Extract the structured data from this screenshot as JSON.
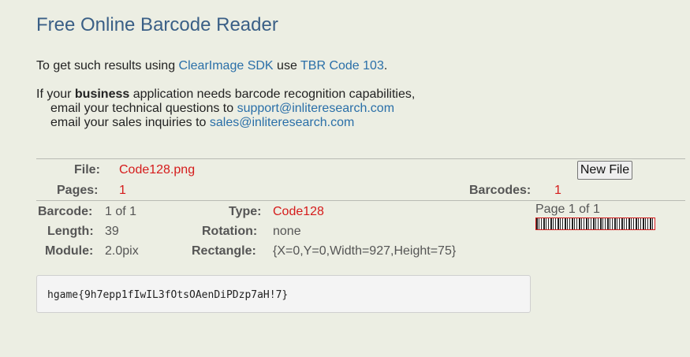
{
  "title": "Free Online Barcode Reader",
  "intro": {
    "prefix": "To get such results using ",
    "sdk_link": "ClearImage SDK",
    "middle": " use ",
    "tbr_link": "TBR Code 103",
    "suffix": "."
  },
  "business": {
    "line1_prefix": "If your ",
    "line1_bold": "business",
    "line1_suffix": " application needs barcode recognition capabilities,",
    "line2_prefix": "email your technical questions to ",
    "support_email": "support@inliteresearch.com",
    "line3_prefix": "email your sales inquiries to ",
    "sales_email": "sales@inliteresearch.com"
  },
  "file_info": {
    "file_label": "File:",
    "file_name": "Code128.png",
    "pages_label": "Pages:",
    "pages_value": "1",
    "barcodes_label": "Barcodes:",
    "barcodes_value": "1",
    "new_file_button": "New File"
  },
  "barcode": {
    "barcode_label": "Barcode:",
    "barcode_value": "1 of 1",
    "type_label": "Type:",
    "type_value": "Code128",
    "length_label": "Length:",
    "length_value": "39",
    "rotation_label": "Rotation:",
    "rotation_value": "none",
    "module_label": "Module:",
    "module_value": "2.0pix",
    "rectangle_label": "Rectangle:",
    "rectangle_value": "{X=0,Y=0,Width=927,Height=75}",
    "page_label": "Page 1 of 1",
    "decoded_text": "hgame{9h7epp1fIwIL3fOtsOAenDiPDzp7aH!7}"
  },
  "colors": {
    "background": "#eceee3",
    "title": "#3a5f86",
    "link": "#2a6fa8",
    "value_red": "#d51b1b"
  }
}
